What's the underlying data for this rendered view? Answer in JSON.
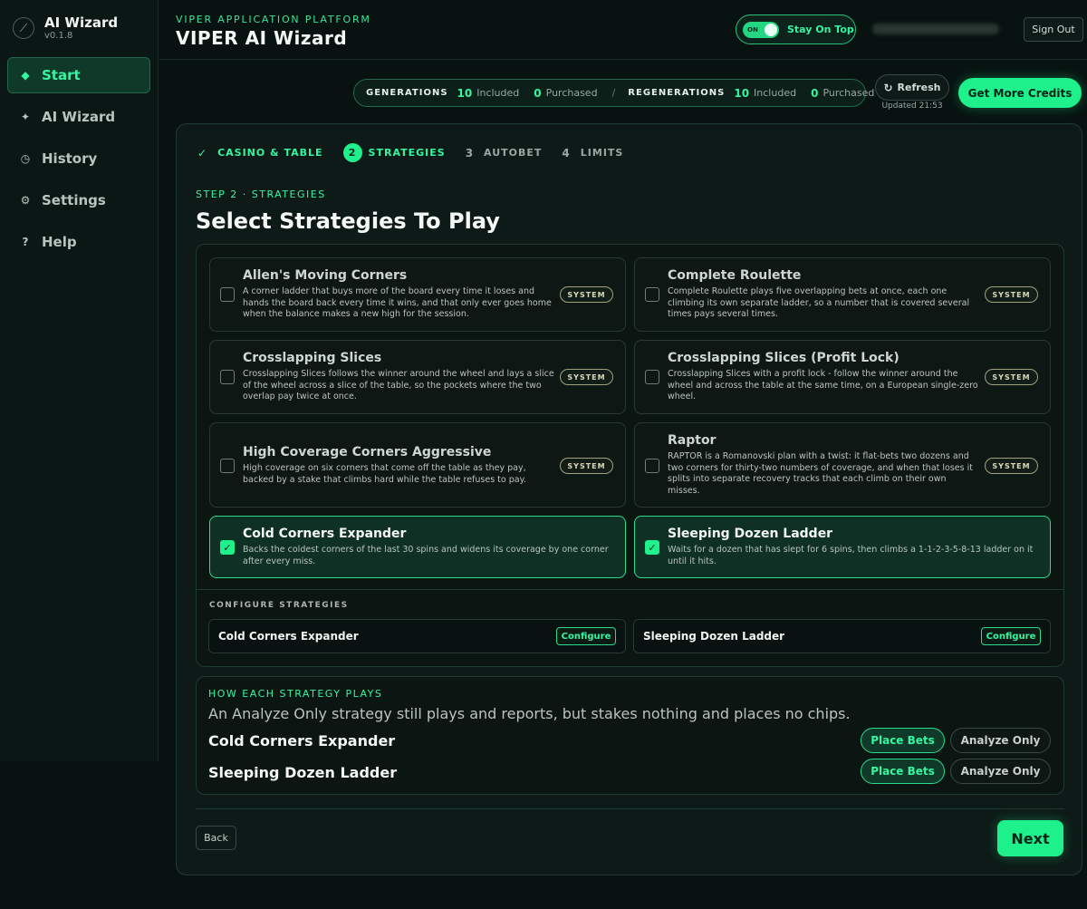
{
  "sidebar": {
    "brand_title": "AI Wizard",
    "brand_version": "v0.1.8",
    "items": [
      {
        "label": "Start",
        "icon": "diamond-icon",
        "glyph": "◆"
      },
      {
        "label": "AI Wizard",
        "icon": "sparkle-icon",
        "glyph": "✦"
      },
      {
        "label": "History",
        "icon": "clock-icon",
        "glyph": "◷"
      },
      {
        "label": "Settings",
        "icon": "gear-icon",
        "glyph": "⚙"
      },
      {
        "label": "Help",
        "icon": "question-icon",
        "glyph": "?"
      }
    ],
    "active_index": 0
  },
  "header": {
    "eyebrow": "VIPER APPLICATION PLATFORM",
    "title": "VIPER AI Wizard",
    "stay_on_top": {
      "toggle_label": "ON",
      "label": "Stay On Top",
      "enabled": true
    },
    "sign_out": "Sign Out"
  },
  "credits": {
    "generations_label": "GENERATIONS",
    "generations_included": "10",
    "included_label": "Included",
    "generations_purchased": "0",
    "purchased_label": "Purchased",
    "separator": "/",
    "regenerations_label": "REGENERATIONS",
    "regenerations_included": "10",
    "regenerations_purchased": "0",
    "refresh": "Refresh",
    "updated": "Updated 21:53",
    "get_more": "Get More Credits"
  },
  "wizard": {
    "steps": [
      {
        "mark": "✓",
        "label": "CASINO & TABLE",
        "state": "done"
      },
      {
        "mark": "2",
        "label": "STRATEGIES",
        "state": "current"
      },
      {
        "mark": "3",
        "label": "AUTOBET",
        "state": "todo"
      },
      {
        "mark": "4",
        "label": "LIMITS",
        "state": "todo"
      }
    ],
    "step_eyebrow": "STEP 2 · STRATEGIES",
    "step_title": "Select Strategies To Play",
    "strategies": [
      {
        "title": "Allen's Moving Corners",
        "desc": "A corner ladder that buys more of the board every time it loses and hands the board back every time it wins, and that only ever goes home when the balance makes a new high for the session.",
        "badge": "SYSTEM",
        "selected": false
      },
      {
        "title": "Complete Roulette",
        "desc": "Complete Roulette plays five overlapping bets at once, each one climbing its own separate ladder, so a number that is covered several times pays several times.",
        "badge": "SYSTEM",
        "selected": false
      },
      {
        "title": "Crosslapping Slices",
        "desc": "Crosslapping Slices follows the winner around the wheel and lays a slice of the wheel across a slice of the table, so the pockets where the two overlap pay twice at once.",
        "badge": "SYSTEM",
        "selected": false
      },
      {
        "title": "Crosslapping Slices (Profit Lock)",
        "desc": "Crosslapping Slices with a profit lock - follow the winner around the wheel and across the table at the same time, on a European single-zero wheel.",
        "badge": "SYSTEM",
        "selected": false
      },
      {
        "title": "High Coverage Corners Aggressive",
        "desc": "High coverage on six corners that come off the table as they pay, backed by a stake that climbs hard while the table refuses to pay.",
        "badge": "SYSTEM",
        "selected": false
      },
      {
        "title": "Raptor",
        "desc": "RAPTOR is a Romanovski plan with a twist: it flat-bets two dozens and two corners for thirty-two numbers of coverage, and when that loses it splits into separate recovery tracks that each climb on their own misses.",
        "badge": "SYSTEM",
        "selected": false
      },
      {
        "title": "Cold Corners Expander",
        "desc": "Backs the coldest corners of the last 30 spins and widens its coverage by one corner after every miss.",
        "badge": "",
        "selected": true
      },
      {
        "title": "Sleeping Dozen Ladder",
        "desc": "Waits for a dozen that has slept for 6 spins, then climbs a 1-1-2-3-5-8-13 ladder on it until it hits.",
        "badge": "",
        "selected": true
      }
    ],
    "check_glyph": "✓",
    "configure_label": "CONFIGURE STRATEGIES",
    "configure_rows": [
      {
        "name": "Cold Corners Expander",
        "button": "Configure"
      },
      {
        "name": "Sleeping Dozen Ladder",
        "button": "Configure"
      }
    ],
    "how": {
      "eyebrow": "HOW EACH STRATEGY PLAYS",
      "note": "An Analyze Only strategy still plays and reports, but stakes nothing and places no chips.",
      "rows": [
        {
          "name": "Cold Corners Expander",
          "place": "Place Bets",
          "analyze": "Analyze Only",
          "mode": "place"
        },
        {
          "name": "Sleeping Dozen Ladder",
          "place": "Place Bets",
          "analyze": "Analyze Only",
          "mode": "place"
        }
      ]
    },
    "back": "Back",
    "next": "Next"
  },
  "colors": {
    "accent": "#1ef08b",
    "accent_text": "#35f5a0",
    "background": "#081311",
    "panel": "#0e1a17"
  }
}
